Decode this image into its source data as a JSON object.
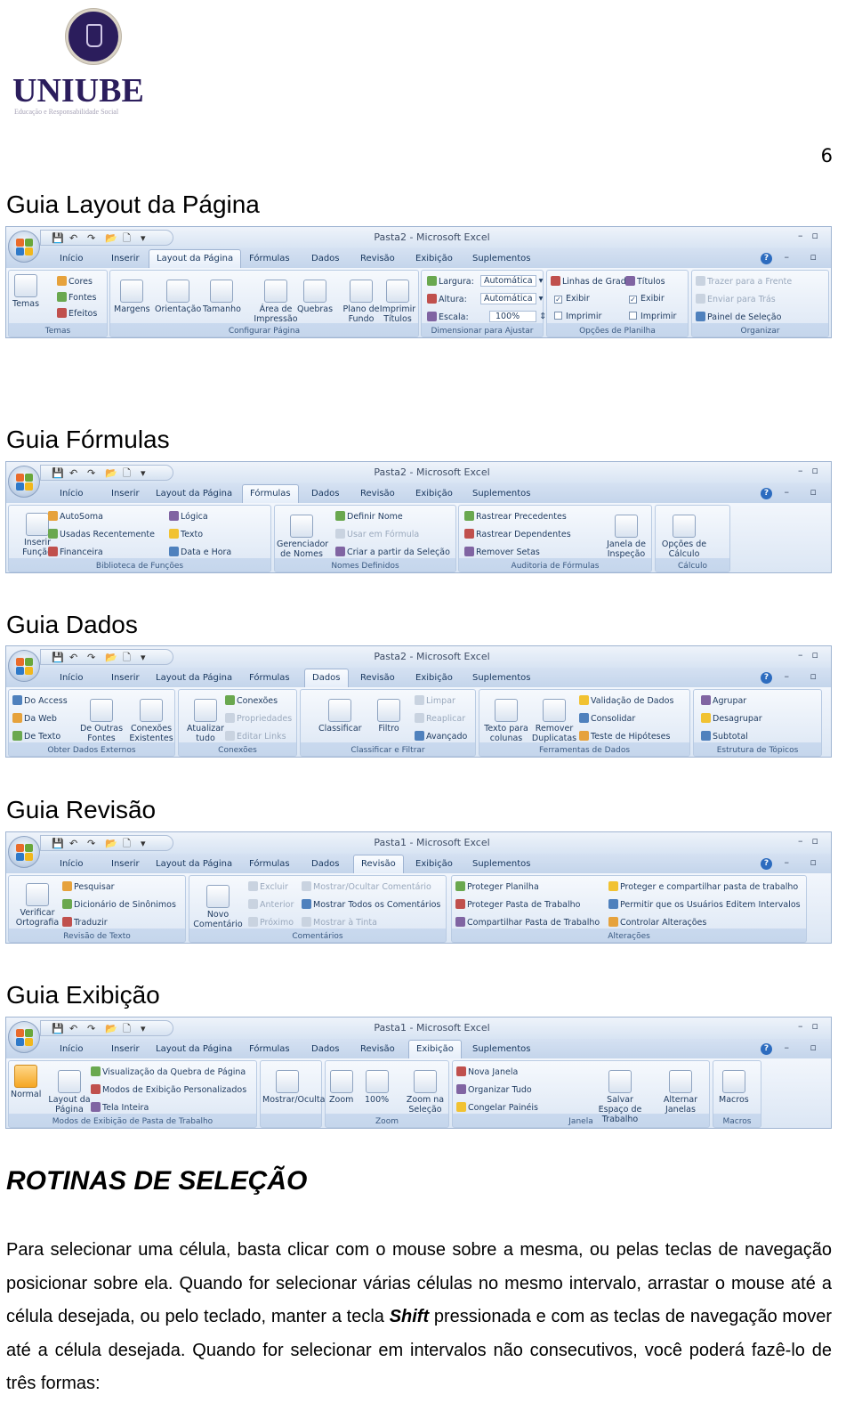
{
  "header": {
    "logo": {
      "name": "UNIUBE",
      "tagline": "Educação e Responsabilidade Social"
    },
    "page_number": "6"
  },
  "common_ribbon": {
    "quick_access": [
      "save-icon",
      "undo-icon",
      "redo-icon",
      "open-icon",
      "new-icon",
      "customize-dropdown"
    ],
    "app_suffix": " - Microsoft Excel",
    "tabs": [
      "Início",
      "Inserir",
      "Layout da Página",
      "Fórmulas",
      "Dados",
      "Revisão",
      "Exibição",
      "Suplementos"
    ]
  },
  "sections": [
    {
      "title": "Guia Layout da Página",
      "window_title": "Pasta2 - Microsoft Excel",
      "active_tab": "Layout da Página",
      "groups": [
        {
          "label": "Temas",
          "items": [
            "Temas",
            "Cores",
            "Fontes",
            "Efeitos"
          ]
        },
        {
          "label": "Configurar Página",
          "items": [
            "Margens",
            "Orientação",
            "Tamanho",
            "Área de Impressão",
            "Quebras",
            "Plano de Fundo",
            "Imprimir Títulos"
          ]
        },
        {
          "label": "Dimensionar para Ajustar",
          "items": [
            "Largura:",
            "Altura:",
            "Escala:"
          ],
          "values": {
            "largura": "Automática",
            "altura": "Automática",
            "escala": "100%"
          }
        },
        {
          "label": "Opções de Planilha",
          "items": [
            "Linhas de Grade",
            "Títulos",
            "Exibir",
            "Imprimir",
            "Exibir",
            "Imprimir"
          ],
          "checked": {
            "grade_exibir": true,
            "grade_imprimir": false,
            "titulos_exibir": true,
            "titulos_imprimir": false
          }
        },
        {
          "label": "Organizar",
          "items": [
            "Trazer para a Frente",
            "Enviar para Trás",
            "Painel de Seleção"
          ]
        }
      ]
    },
    {
      "title": "Guia Fórmulas",
      "window_title": "Pasta2 - Microsoft Excel",
      "active_tab": "Fórmulas",
      "groups": [
        {
          "label": "Biblioteca de Funções",
          "items": [
            "Inserir Função",
            "AutoSoma",
            "Usadas Recentemente",
            "Financeira",
            "Lógica",
            "Texto",
            "Data e Hora"
          ]
        },
        {
          "label": "Nomes Definidos",
          "items": [
            "Gerenciador de Nomes",
            "Definir Nome",
            "Usar em Fórmula",
            "Criar a partir da Seleção"
          ]
        },
        {
          "label": "Auditoria de Fórmulas",
          "items": [
            "Rastrear Precedentes",
            "Rastrear Dependentes",
            "Remover Setas",
            "Janela de Inspeção"
          ]
        },
        {
          "label": "Cálculo",
          "items": [
            "Opções de Cálculo"
          ]
        }
      ]
    },
    {
      "title": "Guia Dados",
      "window_title": "Pasta2 - Microsoft Excel",
      "active_tab": "Dados",
      "groups": [
        {
          "label": "Obter Dados Externos",
          "items": [
            "Do Access",
            "Da Web",
            "De Texto",
            "De Outras Fontes",
            "Conexões Existentes"
          ]
        },
        {
          "label": "Conexões",
          "items": [
            "Atualizar tudo",
            "Conexões",
            "Propriedades",
            "Editar Links"
          ]
        },
        {
          "label": "Classificar e Filtrar",
          "items": [
            "Classificar",
            "Filtro",
            "Limpar",
            "Reaplicar",
            "Avançado"
          ]
        },
        {
          "label": "Ferramentas de Dados",
          "items": [
            "Texto para colunas",
            "Remover Duplicatas",
            "Validação de Dados",
            "Consolidar",
            "Teste de Hipóteses"
          ]
        },
        {
          "label": "Estrutura de Tópicos",
          "items": [
            "Agrupar",
            "Desagrupar",
            "Subtotal"
          ]
        }
      ]
    },
    {
      "title": "Guia Revisão",
      "window_title": "Pasta1 - Microsoft Excel",
      "active_tab": "Revisão",
      "groups": [
        {
          "label": "Revisão de Texto",
          "items": [
            "Verificar Ortografia",
            "Pesquisar",
            "Dicionário de Sinônimos",
            "Traduzir"
          ]
        },
        {
          "label": "Comentários",
          "items": [
            "Novo Comentário",
            "Excluir",
            "Anterior",
            "Próximo",
            "Mostrar/Ocultar Comentário",
            "Mostrar Todos os Comentários",
            "Mostrar à Tinta"
          ]
        },
        {
          "label": "Alterações",
          "items": [
            "Proteger Planilha",
            "Proteger Pasta de Trabalho",
            "Compartilhar Pasta de Trabalho",
            "Proteger e compartilhar pasta de trabalho",
            "Permitir que os Usuários Editem Intervalos",
            "Controlar Alterações"
          ]
        }
      ]
    },
    {
      "title": "Guia Exibição",
      "window_title": "Pasta1 - Microsoft Excel",
      "active_tab": "Exibição",
      "groups": [
        {
          "label": "Modos de Exibição de Pasta de Trabalho",
          "items": [
            "Normal",
            "Layout da Página",
            "Visualização da Quebra de Página",
            "Modos de Exibição Personalizados",
            "Tela Inteira"
          ]
        },
        {
          "label": "",
          "items": [
            "Mostrar/Ocultar"
          ]
        },
        {
          "label": "Zoom",
          "items": [
            "Zoom",
            "100%",
            "Zoom na Seleção"
          ]
        },
        {
          "label": "Janela",
          "items": [
            "Nova Janela",
            "Organizar Tudo",
            "Congelar Painéis",
            "Salvar Espaço de Trabalho",
            "Alternar Janelas"
          ]
        },
        {
          "label": "Macros",
          "items": [
            "Macros"
          ]
        }
      ]
    }
  ],
  "rotinas": {
    "heading": "ROTINAS DE SELEÇÃO",
    "paragraph_before_bold": "Para selecionar uma célula, basta clicar com o mouse sobre a mesma, ou pelas teclas de navegação posicionar sobre ela. Quando for selecionar várias células no mesmo intervalo, arrastar o mouse até a célula desejada, ou pelo teclado, manter a tecla ",
    "bold_word": "Shift",
    "paragraph_after_bold": " pressionada e com as teclas de navegação mover até a célula desejada. Quando for selecionar em intervalos não consecutivos, você poderá fazê-lo de três formas:"
  }
}
